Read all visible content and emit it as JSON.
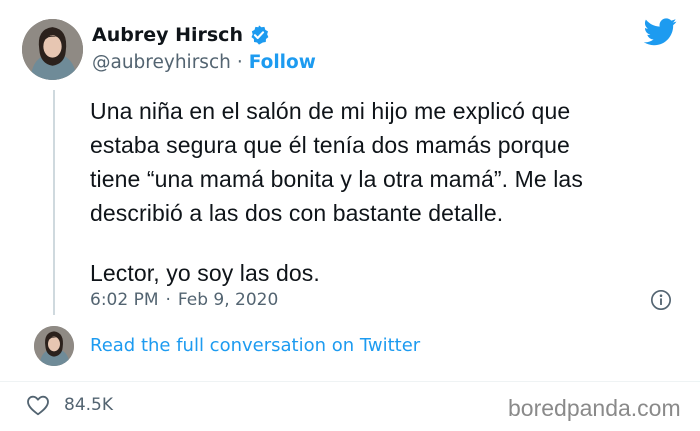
{
  "tweet": {
    "author_name": "Aubrey Hirsch",
    "author_handle": "@aubreyhirsch",
    "separator": "·",
    "follow_label": "Follow",
    "text_lines": [
      "Una niña en el salón de mi hijo me explicó que",
      "estaba segura que él tenía dos mamás porque",
      "tiene “una mamá bonita y la otra mamá”. Me las",
      "describió a las dos con bastante detalle."
    ],
    "text_line_2": "Lector, yo soy las dos.",
    "time": "6:02 PM",
    "date": "Feb 9, 2020",
    "read_more_label": "Read the full conversation on Twitter",
    "like_count": "84.5K"
  },
  "icons": {
    "brand": "twitter-bird-icon",
    "verified": "verified-badge-icon",
    "info": "info-icon",
    "like": "heart-icon"
  },
  "colors": {
    "twitter_blue": "#1d9bf0",
    "text_primary": "#0f1419",
    "text_secondary": "#536471"
  },
  "watermark": "boredpanda.com"
}
